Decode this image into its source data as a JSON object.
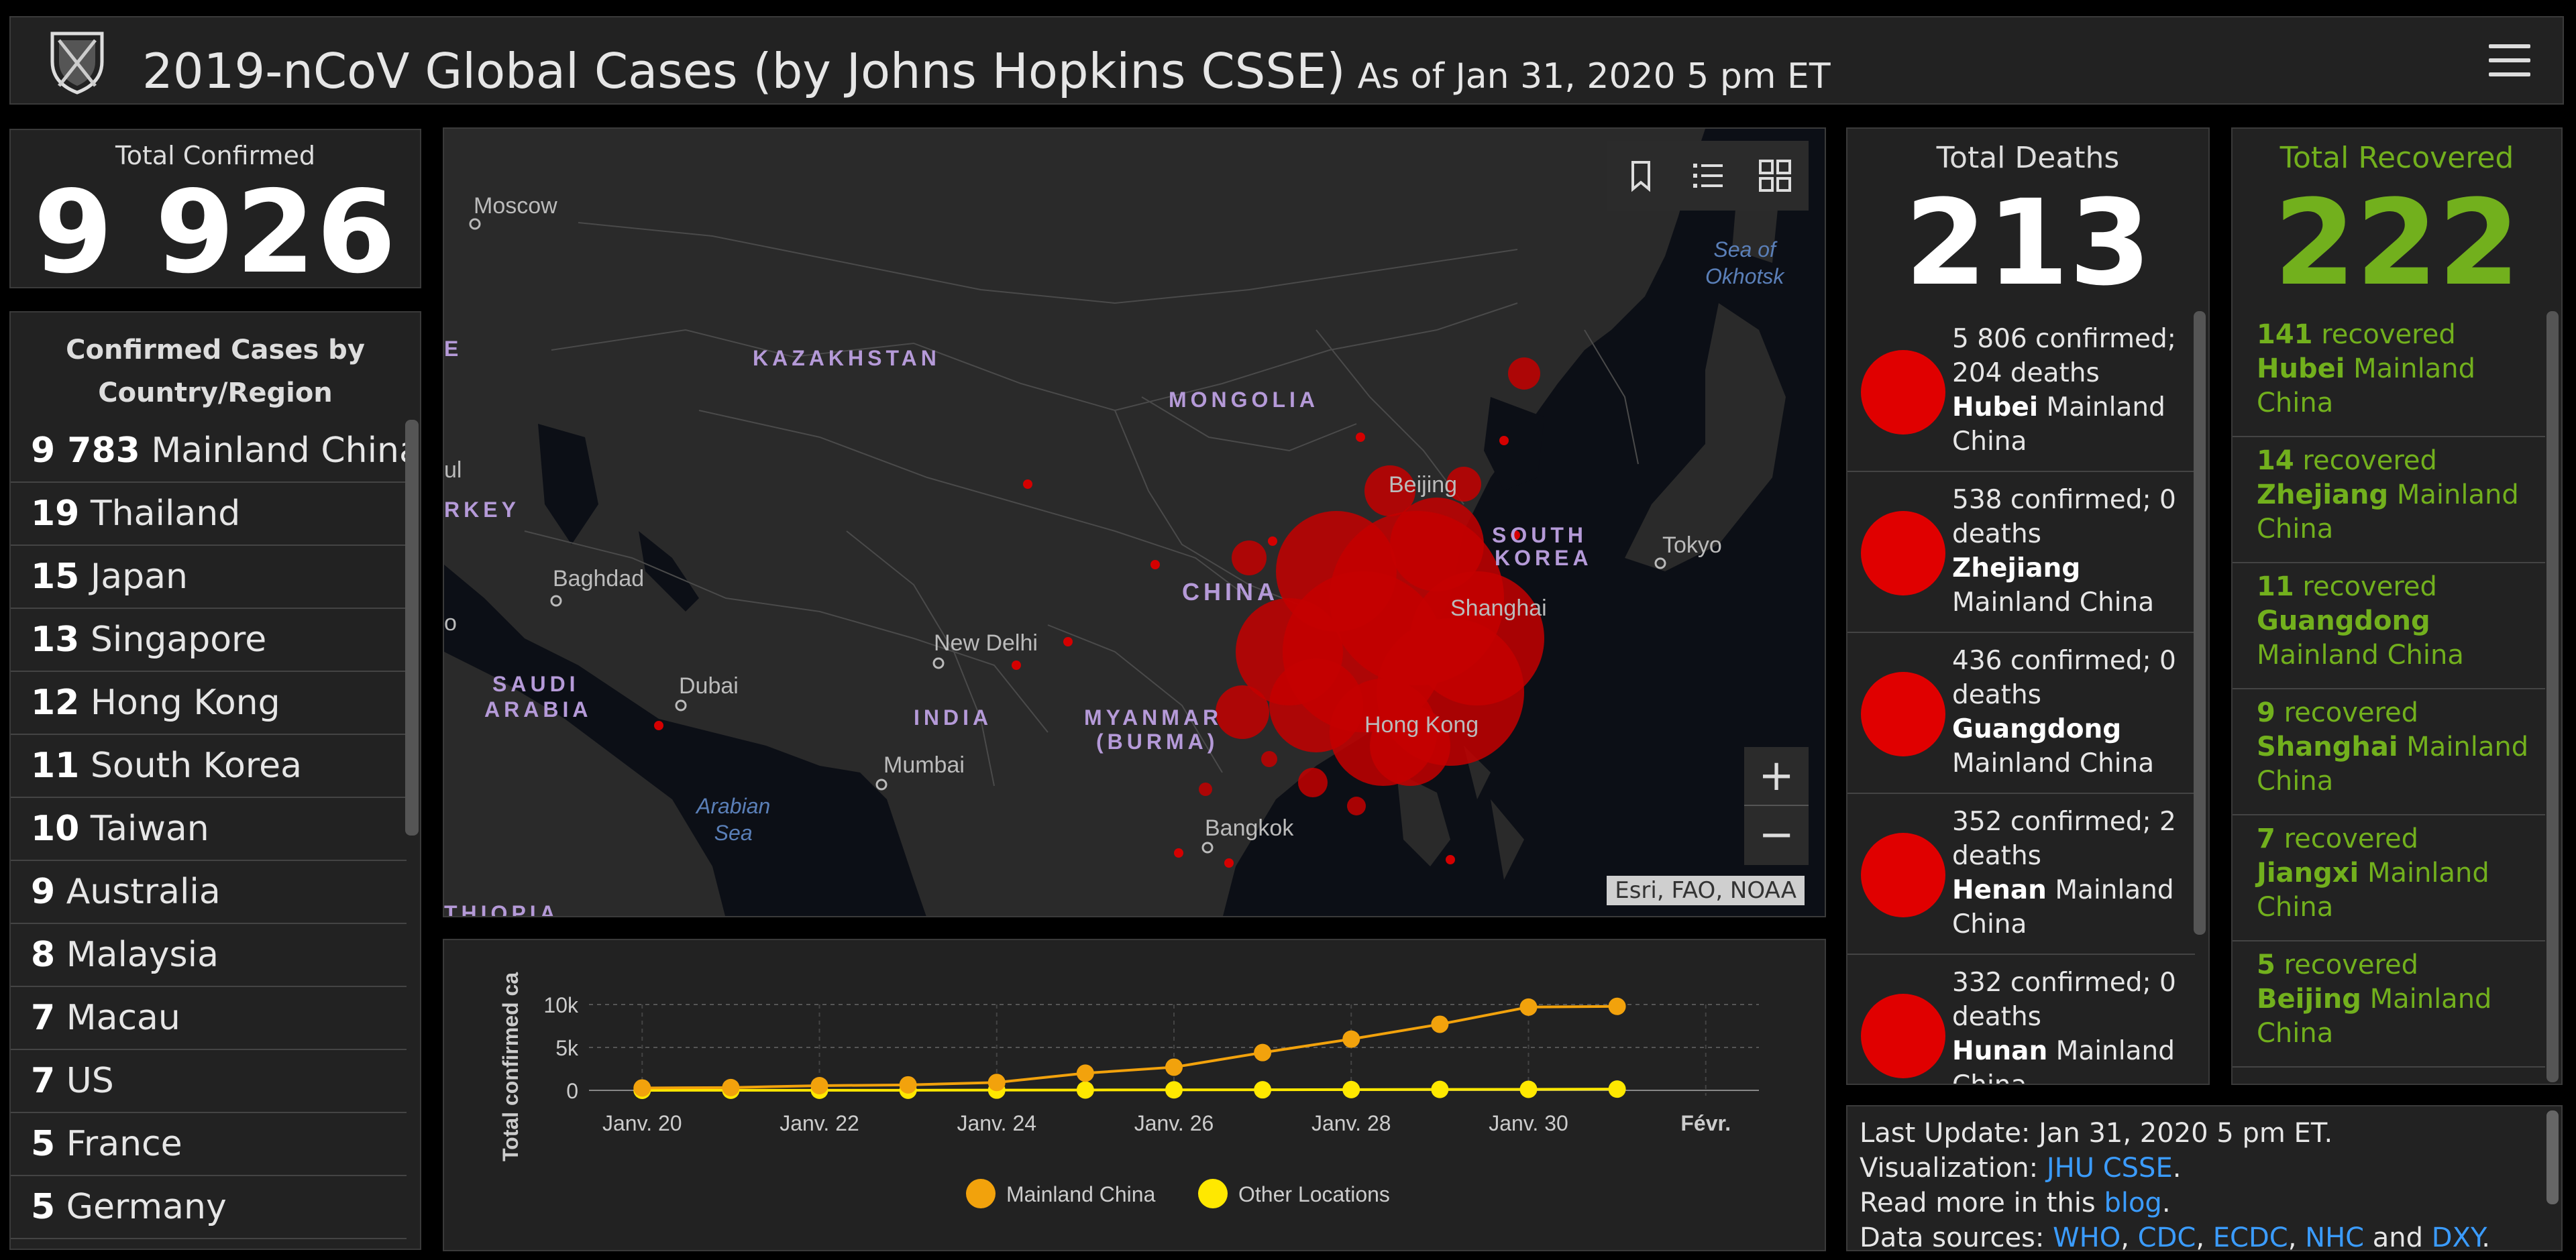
{
  "header": {
    "title": "2019-nCoV Global Cases (by Johns Hopkins CSSE)",
    "as_of": "As of Jan 31, 2020 5 pm ET"
  },
  "confirmed": {
    "label": "Total Confirmed",
    "value": "9 926"
  },
  "countries": {
    "title_line1": "Confirmed Cases by",
    "title_line2": "Country/Region",
    "items": [
      {
        "count": "9 783",
        "name": "Mainland China"
      },
      {
        "count": "19",
        "name": "Thailand"
      },
      {
        "count": "15",
        "name": "Japan"
      },
      {
        "count": "13",
        "name": "Singapore"
      },
      {
        "count": "12",
        "name": "Hong Kong"
      },
      {
        "count": "11",
        "name": "South Korea"
      },
      {
        "count": "10",
        "name": "Taiwan"
      },
      {
        "count": "9",
        "name": "Australia"
      },
      {
        "count": "8",
        "name": "Malaysia"
      },
      {
        "count": "7",
        "name": "Macau"
      },
      {
        "count": "7",
        "name": "US"
      },
      {
        "count": "5",
        "name": "France"
      },
      {
        "count": "5",
        "name": "Germany"
      }
    ]
  },
  "map": {
    "cities": [
      "Moscow",
      "Baghdad",
      "Dubai",
      "New Delhi",
      "Mumbai",
      "Bangkok",
      "Hong Kong",
      "Shanghai",
      "Beijing",
      "Tokyo"
    ],
    "countries": [
      "KAZAKHSTAN",
      "MONGOLIA",
      "CHINA",
      "INDIA",
      "SAUDI",
      "ARABIA",
      "MYANMAR",
      "(BURMA)",
      "SOUTH",
      "KOREA",
      "RKEY",
      "THIOPIA"
    ],
    "seas": [
      "Sea of",
      "Okhotsk",
      "Arabian",
      "Sea"
    ],
    "attribution": "Esri, FAO, NOAA",
    "zoom_in": "+",
    "zoom_out": "−",
    "fragments": [
      "E",
      "ul",
      "o"
    ]
  },
  "chart_data": {
    "type": "line",
    "ylabel": "Total confirmed ca",
    "ylim": [
      0,
      10000
    ],
    "yticks": [
      "0",
      "5k",
      "10k"
    ],
    "xticks": [
      "Janv. 20",
      "Janv. 22",
      "Janv. 24",
      "Janv. 26",
      "Janv. 28",
      "Janv. 30",
      "Févr."
    ],
    "x": [
      "Jan 20",
      "Jan 21",
      "Jan 22",
      "Jan 23",
      "Jan 24",
      "Jan 25",
      "Jan 26",
      "Jan 27",
      "Jan 28",
      "Jan 29",
      "Jan 30",
      "Jan 31"
    ],
    "series": [
      {
        "name": "Mainland China",
        "color": "#f2a20c",
        "values": [
          278,
          326,
          547,
          639,
          916,
          2000,
          2700,
          4400,
          5970,
          7700,
          9700,
          9783
        ]
      },
      {
        "name": "Other Locations",
        "color": "#ffe800",
        "values": [
          4,
          6,
          8,
          14,
          25,
          40,
          57,
          64,
          87,
          105,
          118,
          143
        ]
      }
    ]
  },
  "deaths": {
    "label": "Total Deaths",
    "value": "213",
    "items": [
      {
        "stats": "5 806 confirmed; 204 deaths",
        "region": "Hubei",
        "country": "Mainland China"
      },
      {
        "stats": "538 confirmed; 0 deaths",
        "region": "Zhejiang",
        "country": "Mainland China"
      },
      {
        "stats": "436 confirmed; 0 deaths",
        "region": "Guangdong",
        "country": "Mainland China"
      },
      {
        "stats": "352 confirmed; 2 deaths",
        "region": "Henan",
        "country": "Mainland China"
      },
      {
        "stats": "332 confirmed; 0 deaths",
        "region": "Hunan",
        "country": "Mainland China"
      }
    ]
  },
  "recovered": {
    "label": "Total Recovered",
    "value": "222",
    "items": [
      {
        "count": "141",
        "word": "recovered",
        "region": "Hubei",
        "country": "Mainland China"
      },
      {
        "count": "14",
        "word": "recovered",
        "region": "Zhejiang",
        "country": "Mainland China"
      },
      {
        "count": "11",
        "word": "recovered",
        "region": "Guangdong",
        "country": "Mainland China"
      },
      {
        "count": "9",
        "word": "recovered",
        "region": "Shanghai",
        "country": "Mainland China"
      },
      {
        "count": "7",
        "word": "recovered",
        "region": "Jiangxi",
        "country": "Mainland China"
      },
      {
        "count": "5",
        "word": "recovered",
        "region": "Beijing",
        "country": "Mainland China"
      }
    ]
  },
  "info": {
    "last_update": "Last Update: Jan 31, 2020 5 pm ET.",
    "viz_prefix": "Visualization: ",
    "viz_link": "JHU CSSE",
    "blog_prefix": "Read more in this ",
    "blog_link": "blog",
    "sources_prefix": "Data sources: ",
    "sources": [
      "WHO",
      "CDC",
      "ECDC",
      "NHC",
      "DXY"
    ],
    "and": " and "
  },
  "colors": {
    "accent_green": "#72b01d",
    "dot_red": "#e00000",
    "link_blue": "#3b9cff"
  }
}
